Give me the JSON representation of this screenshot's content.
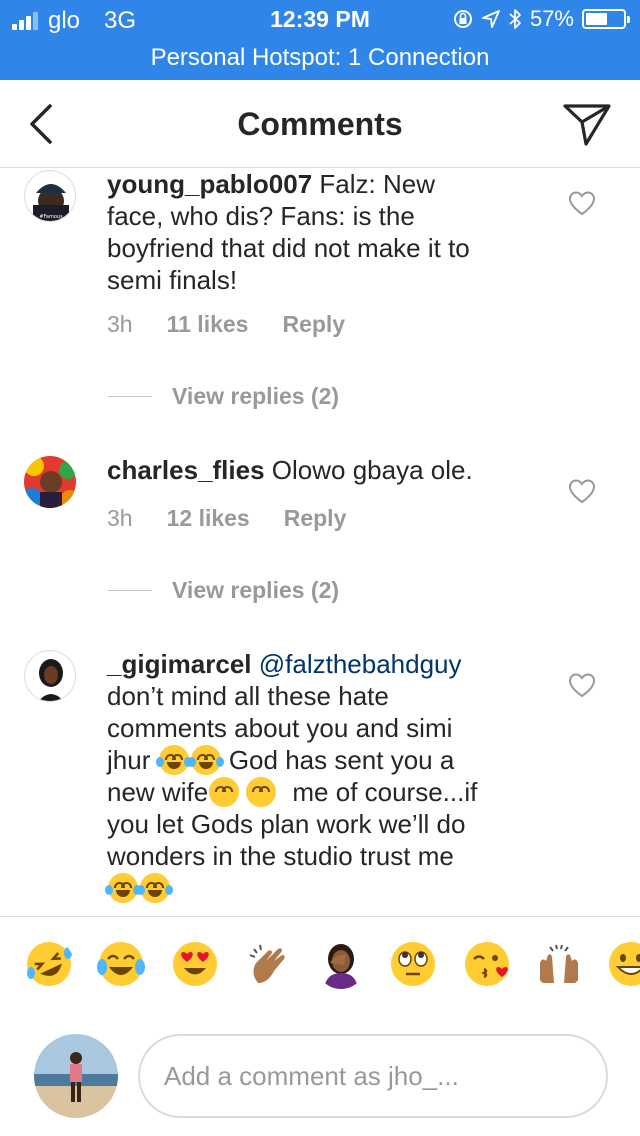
{
  "status_bar": {
    "carrier": "glo",
    "network": "3G",
    "time": "12:39 PM",
    "battery": "57%",
    "battery_level": 0.57
  },
  "hotspot": {
    "text": "Personal Hotspot: 1 Connection"
  },
  "header": {
    "title": "Comments",
    "back_icon": "chevron-left-icon",
    "share_icon": "paper-plane-icon"
  },
  "comments": [
    {
      "username": "young_pablo007",
      "text_lines": [
        "Falz: New",
        "face, who dis? Fans: is the",
        "boyfriend that did not make it to",
        "semi finals!"
      ],
      "time": "3h",
      "likes": "11 likes",
      "reply": "Reply",
      "view_replies": "View replies (2)"
    },
    {
      "username": "charles_flies",
      "text_lines": [
        "Olowo gbaya ole."
      ],
      "time": "3h",
      "likes": "12 likes",
      "reply": "Reply",
      "view_replies": "View replies (2)"
    },
    {
      "username": "_gigimarcel",
      "mention": "@falzthebahdguy",
      "text_lines": [
        "don’t mind all these hate",
        "comments about you and simi",
        "jhur",
        "God has sent you a",
        "new wife",
        "me of course...if",
        "you let Gods plan work we’ll do",
        "wonders in the studio trust me"
      ]
    }
  ],
  "emoji_bar": [
    "rofl-emoji-icon",
    "joy-emoji-icon",
    "heart-eyes-emoji-icon",
    "clapping-hands-emoji-icon",
    "facepalm-emoji-icon",
    "eye-roll-emoji-icon",
    "kissing-heart-emoji-icon",
    "raised-hands-emoji-icon",
    "grinning-emoji-icon"
  ],
  "composer": {
    "placeholder": "Add a comment as jho_..."
  },
  "colors": {
    "accent": "#2f86e8",
    "muted": "#999999",
    "mention": "#003569"
  }
}
